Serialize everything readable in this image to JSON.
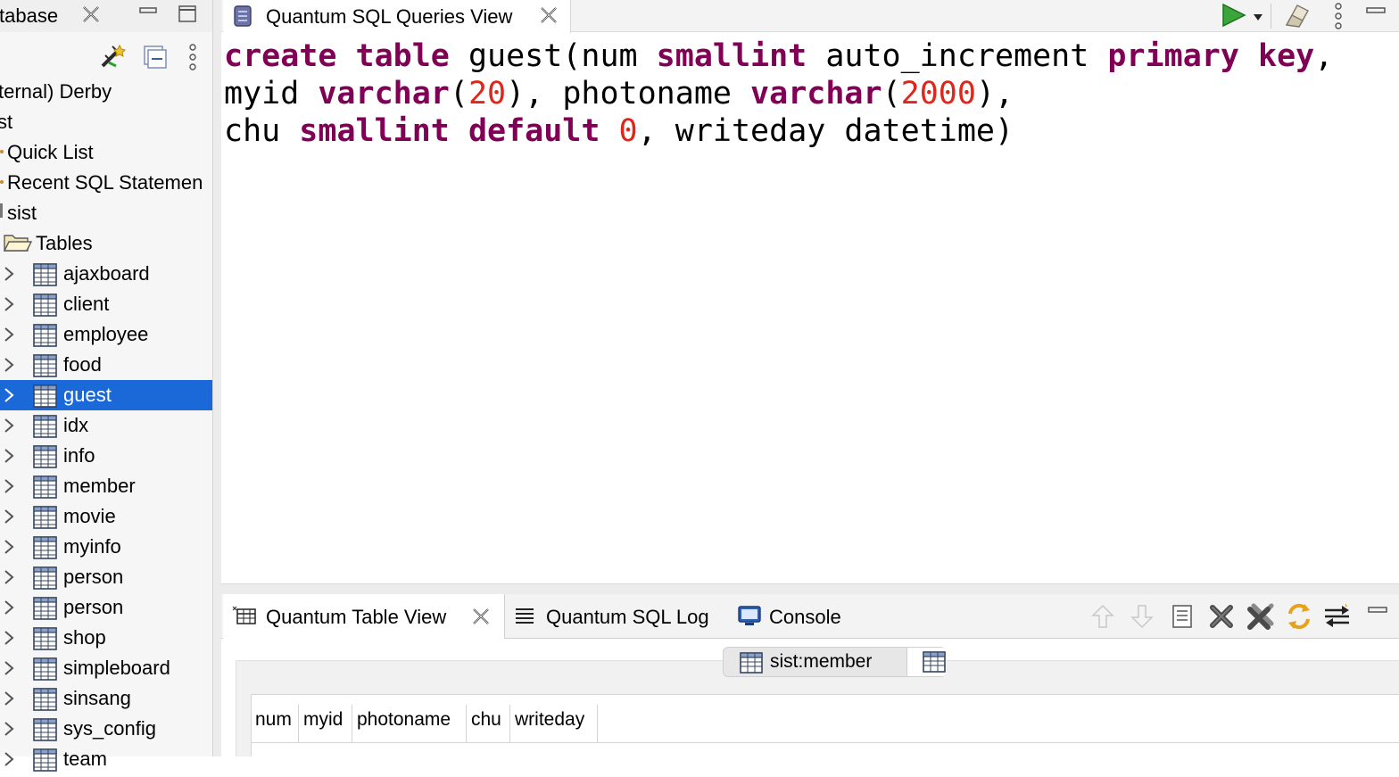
{
  "left_panel": {
    "tab_title": "tabase",
    "tree": [
      {
        "label": "ternal) Derby",
        "level": 0
      },
      {
        "label": "st",
        "level": 0
      },
      {
        "label": "Quick List",
        "level": 1
      },
      {
        "label": "Recent SQL Statemen",
        "level": 1
      },
      {
        "label": "sist",
        "level": 1
      },
      {
        "label": "Tables",
        "level": 2
      }
    ],
    "tables": [
      "ajaxboard",
      "client",
      "employee",
      "food",
      "guest",
      "idx",
      "info",
      "member",
      "movie",
      "myinfo",
      "person",
      "person",
      "shop",
      "simpleboard",
      "sinsang",
      "sys_config",
      "team"
    ],
    "selected_table": "guest"
  },
  "editor": {
    "tab_title": "Quantum SQL Queries View",
    "code_lines": [
      [
        {
          "t": "create",
          "c": "kw"
        },
        {
          "t": " "
        },
        {
          "t": "table",
          "c": "kw"
        },
        {
          "t": " guest(num "
        },
        {
          "t": "smallint",
          "c": "kw"
        },
        {
          "t": " auto_increment "
        },
        {
          "t": "primary",
          "c": "kw"
        },
        {
          "t": " "
        },
        {
          "t": "key",
          "c": "kw"
        },
        {
          "t": ","
        }
      ],
      [
        {
          "t": "myid "
        },
        {
          "t": "varchar",
          "c": "kw"
        },
        {
          "t": "("
        },
        {
          "t": "20",
          "c": "num"
        },
        {
          "t": "), photoname "
        },
        {
          "t": "varchar",
          "c": "kw"
        },
        {
          "t": "("
        },
        {
          "t": "2000",
          "c": "num"
        },
        {
          "t": "),"
        }
      ],
      [
        {
          "t": "chu "
        },
        {
          "t": "smallint",
          "c": "kw"
        },
        {
          "t": " "
        },
        {
          "t": "default",
          "c": "kw"
        },
        {
          "t": " "
        },
        {
          "t": "0",
          "c": "num"
        },
        {
          "t": ", writeday datetime)"
        }
      ]
    ]
  },
  "bottom_panel": {
    "tabs": [
      {
        "label": "Quantum Table View",
        "active": true
      },
      {
        "label": "Quantum SQL Log",
        "active": false
      },
      {
        "label": "Console",
        "active": false
      }
    ],
    "subtab_label": "sist:member",
    "columns": [
      "num",
      "myid",
      "photoname",
      "chu",
      "writeday"
    ]
  },
  "icons": {
    "run": "run-triangle-icon",
    "eraser": "clear-eraser-icon"
  },
  "colors": {
    "selection": "#1b68d9",
    "sql_keyword": "#7f0055",
    "sql_number": "#e0261a"
  }
}
